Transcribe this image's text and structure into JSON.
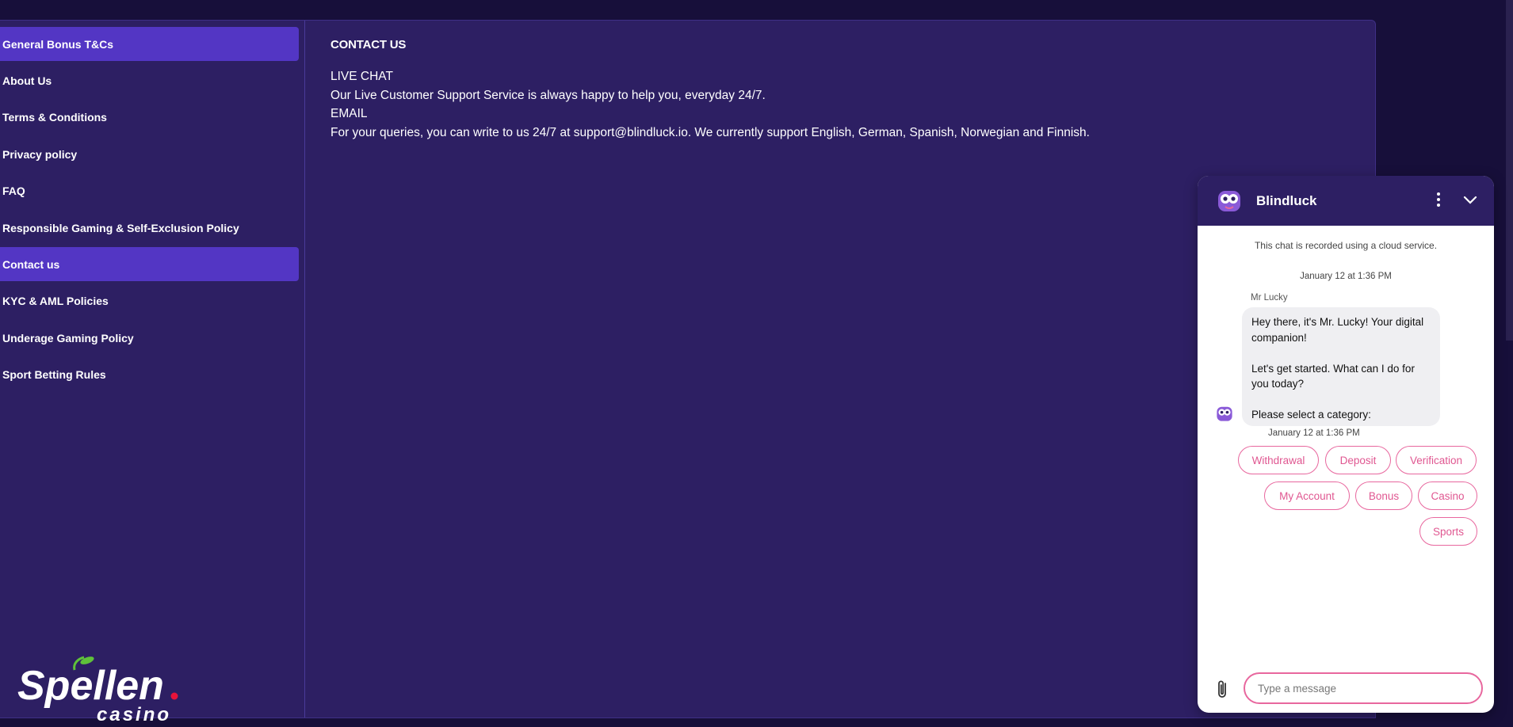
{
  "sidebar": {
    "items": [
      {
        "label": "General Bonus T&Cs"
      },
      {
        "label": "About Us"
      },
      {
        "label": "Terms & Conditions"
      },
      {
        "label": "Privacy policy"
      },
      {
        "label": "FAQ"
      },
      {
        "label": "Responsible Gaming & Self-Exclusion Policy"
      },
      {
        "label": "Contact us"
      },
      {
        "label": "KYC & AML Policies"
      },
      {
        "label": "Underage Gaming Policy"
      },
      {
        "label": "Sport Betting Rules"
      }
    ],
    "active_item": "Contact us",
    "highlighted_item": "General Bonus T&Cs"
  },
  "brand": {
    "logo_text": "Spellen",
    "logo_subtext": "casino",
    "accent_color": "#5336c4",
    "logo_dot_color": "#e8133a"
  },
  "content": {
    "heading": "CONTACT US",
    "lines": [
      "LIVE CHAT",
      "Our Live Customer Support Service is always happy to help you, everyday 24/7.",
      "EMAIL",
      "For your queries, you can write to us 24/7 at support@blindluck.io. We currently support English, German, Spanish, Norwegian and Finnish."
    ]
  },
  "chat": {
    "title": "Blindluck",
    "notice": "This chat is recorded using a cloud service.",
    "date_header": "January 12 at 1:36 PM",
    "sender": "Mr Lucky",
    "message_lines": [
      "Hey there, it's Mr. Lucky! Your digital",
      "companion!",
      "",
      "Let's get started. What can I do for",
      "you today?",
      "",
      "Please select a category:"
    ],
    "message_time": "January 12 at 1:36 PM",
    "options": [
      "Withdrawal",
      "Deposit",
      "Verification",
      "My Account",
      "Bonus",
      "Casino",
      "Sports"
    ],
    "input_placeholder": "Type a message",
    "chip_color": "#e8679e"
  }
}
